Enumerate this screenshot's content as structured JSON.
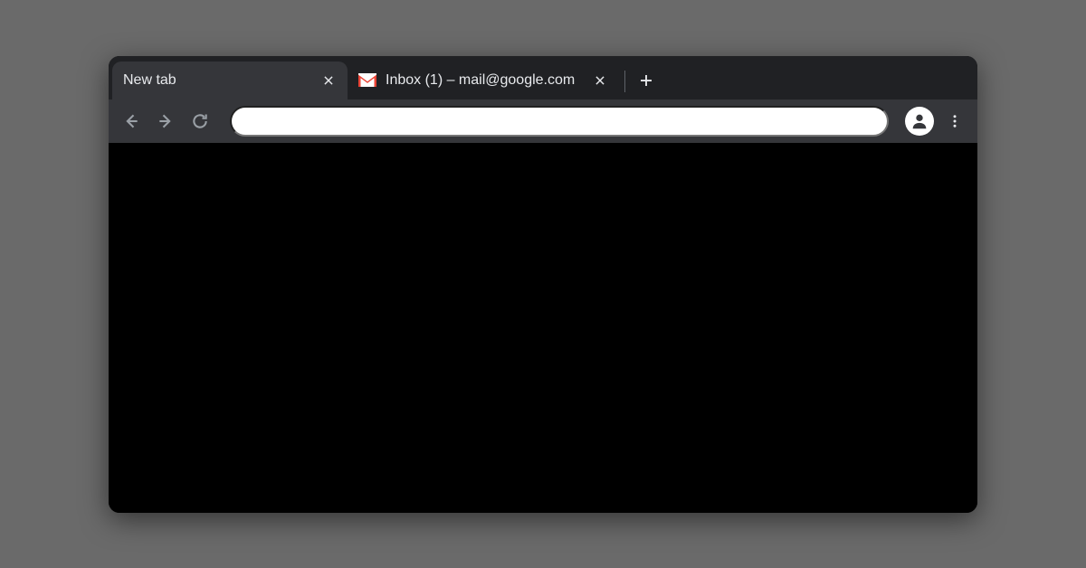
{
  "tabs": [
    {
      "title": "New tab",
      "active": true
    },
    {
      "title": "Inbox (1) – mail@google.com",
      "active": false,
      "favicon": "gmail"
    }
  ],
  "address_bar": {
    "value": ""
  }
}
